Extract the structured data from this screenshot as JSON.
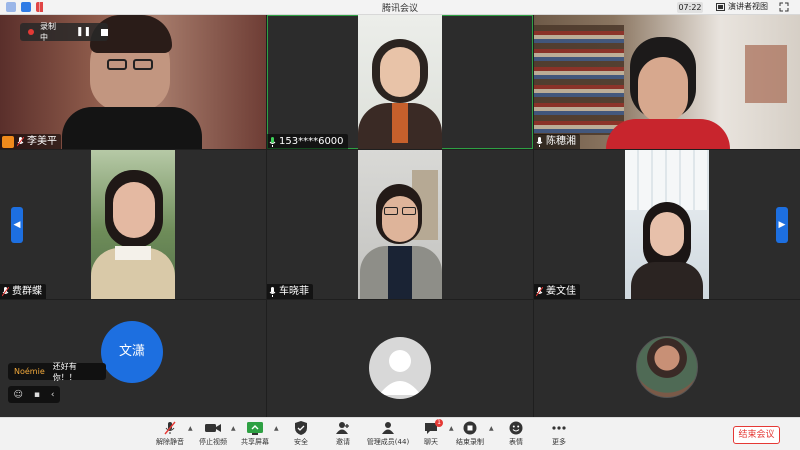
{
  "window": {
    "title": "腾讯会议",
    "time": "07:22",
    "speaker_view_label": "演讲者视图"
  },
  "recording": {
    "label": "录制中"
  },
  "participants": [
    {
      "name": "李美平"
    },
    {
      "name": "153****6000"
    },
    {
      "name": "陈穗湘"
    },
    {
      "name": "费群蝶"
    },
    {
      "name": "车晓菲"
    },
    {
      "name": "姜文佳"
    }
  ],
  "bottom_tiles": {
    "avatar_text": "文潇"
  },
  "chat": {
    "user": "Noémie",
    "message": "还好有你！！"
  },
  "toolbar": {
    "unmute_all": "解除静音",
    "stop_video": "停止视频",
    "share_screen": "共享屏幕",
    "security": "安全",
    "invite": "邀请",
    "manage_members": "管理成员(44)",
    "chat": "聊天",
    "chat_badge": "1",
    "end_recording": "结束录制",
    "reactions": "表情",
    "more": "更多",
    "end_meeting": "结束会议"
  },
  "colors": {
    "accent_blue": "#1d6fe0",
    "end_red": "#e53935",
    "active_speaker_green": "#2ea043"
  }
}
